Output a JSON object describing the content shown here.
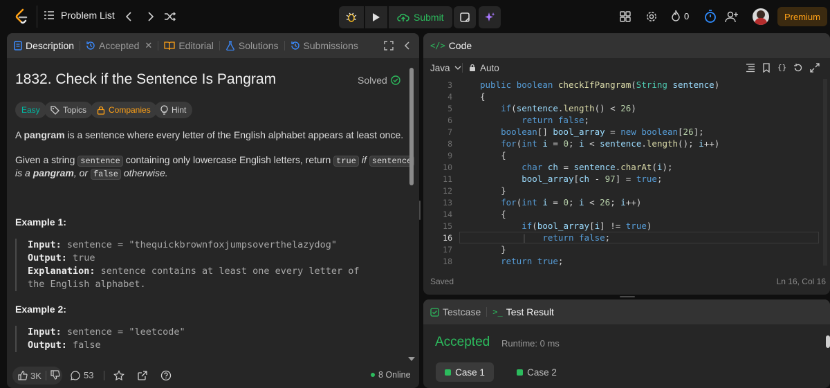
{
  "topbar": {
    "problem_list_label": "Problem List",
    "submit_label": "Submit",
    "streak_count": "0",
    "premium_label": "Premium"
  },
  "description": {
    "tabs": [
      {
        "label": "Description"
      },
      {
        "label": "Accepted"
      },
      {
        "label": "Editorial"
      },
      {
        "label": "Solutions"
      },
      {
        "label": "Submissions"
      }
    ],
    "title": "1832. Check if the Sentence Is Pangram",
    "solved_label": "Solved",
    "chips": {
      "difficulty": "Easy",
      "topics": "Topics",
      "companies": "Companies",
      "hint": "Hint"
    },
    "p1_bold": "pangram",
    "p1_pre": "A ",
    "p1_post": " is a sentence where every letter of the English alphabet appears at least once.",
    "p2_a": "Given a string ",
    "p2_code1": "sentence",
    "p2_b": " containing only lowercase English letters, return ",
    "p2_code2": "true",
    "p2_c": " if ",
    "p2_code3": "sentence",
    "p3_a": "is a ",
    "p3_bold": "pangram",
    "p3_b": ", or ",
    "p3_code": "false",
    "p3_c": " otherwise.",
    "example1": {
      "heading": "Example 1:",
      "input_label": "Input:",
      "input_value": " sentence = \"thequickbrownfoxjumpsoverthelazydog\"",
      "output_label": "Output:",
      "output_value": " true",
      "explanation_label": "Explanation:",
      "explanation_value": " sentence contains at least one every letter of",
      "explanation_value2": "the English alphabet."
    },
    "example2": {
      "heading": "Example 2:",
      "input_label": "Input:",
      "input_value": " sentence = \"leetcode\"",
      "output_label": "Output:",
      "output_value": " false"
    },
    "likes": "3K",
    "comments": "53",
    "online": "8 Online"
  },
  "code": {
    "title": "Code",
    "language": "Java",
    "auto_label": "Auto",
    "saved_label": "Saved",
    "cursor_pos": "Ln 16, Col 16",
    "line_numbers": [
      "3",
      "4",
      "5",
      "6",
      "7",
      "8",
      "9",
      "10",
      "11",
      "12",
      "13",
      "14",
      "15",
      "16",
      "17",
      "18"
    ]
  },
  "testcase": {
    "tab_testcase": "Testcase",
    "tab_result": "Test Result",
    "status": "Accepted",
    "runtime": "Runtime: 0 ms",
    "case1": "Case 1",
    "case2": "Case 2"
  }
}
